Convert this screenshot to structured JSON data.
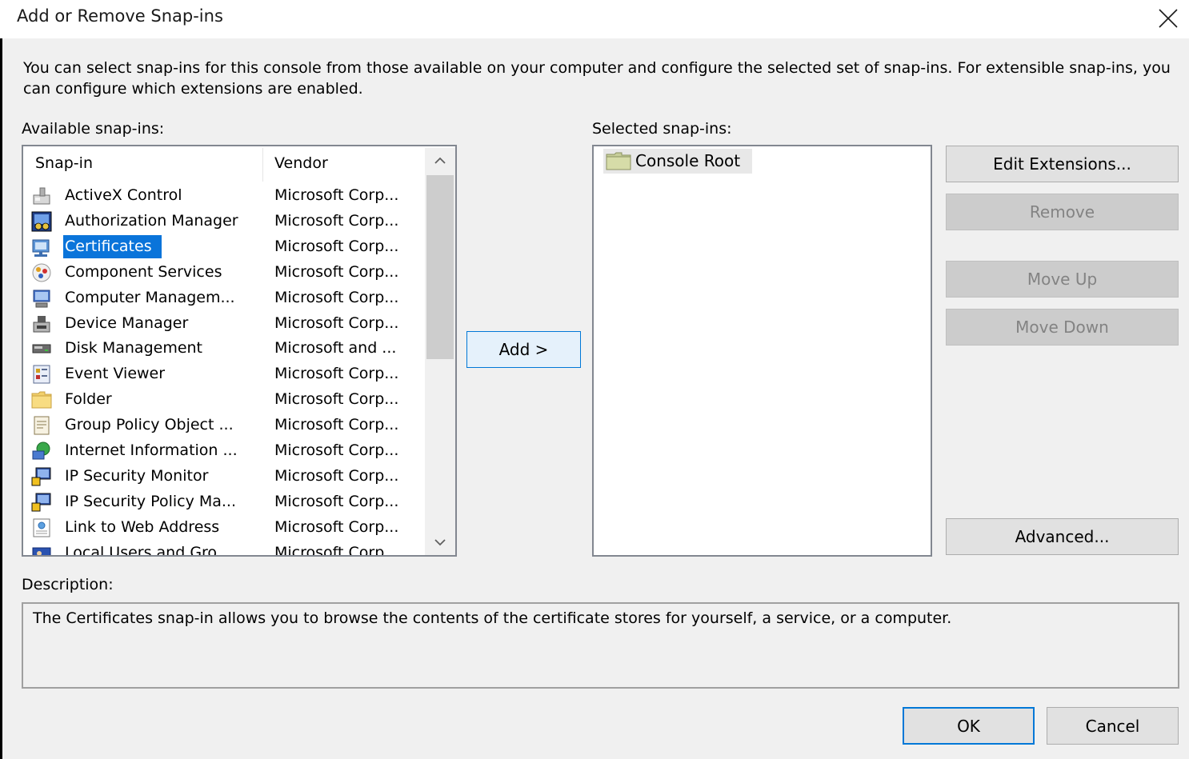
{
  "window": {
    "title": "Add or Remove Snap-ins"
  },
  "intro_text": "You can select snap-ins for this console from those available on your computer and configure the selected set of snap-ins. For extensible snap-ins, you can configure which extensions are enabled.",
  "available": {
    "label": "Available snap-ins:",
    "columns": {
      "snapin": "Snap-in",
      "vendor": "Vendor"
    },
    "items": [
      {
        "name": "ActiveX Control",
        "vendor": "Microsoft Corp...",
        "icon": "activex-control-icon"
      },
      {
        "name": "Authorization Manager",
        "vendor": "Microsoft Corp...",
        "icon": "authorization-manager-icon"
      },
      {
        "name": "Certificates",
        "vendor": "Microsoft Corp...",
        "icon": "certificates-icon",
        "selected": true
      },
      {
        "name": "Component Services",
        "vendor": "Microsoft Corp...",
        "icon": "component-services-icon"
      },
      {
        "name": "Computer Managem...",
        "vendor": "Microsoft Corp...",
        "icon": "computer-management-icon"
      },
      {
        "name": "Device Manager",
        "vendor": "Microsoft Corp...",
        "icon": "device-manager-icon"
      },
      {
        "name": "Disk Management",
        "vendor": "Microsoft and ...",
        "icon": "disk-management-icon"
      },
      {
        "name": "Event Viewer",
        "vendor": "Microsoft Corp...",
        "icon": "event-viewer-icon"
      },
      {
        "name": "Folder",
        "vendor": "Microsoft Corp...",
        "icon": "folder-icon"
      },
      {
        "name": "Group Policy Object ...",
        "vendor": "Microsoft Corp...",
        "icon": "group-policy-icon"
      },
      {
        "name": "Internet Information ...",
        "vendor": "Microsoft Corp...",
        "icon": "iis-icon"
      },
      {
        "name": "IP Security Monitor",
        "vendor": "Microsoft Corp...",
        "icon": "ip-security-monitor-icon"
      },
      {
        "name": "IP Security Policy Ma...",
        "vendor": "Microsoft Corp...",
        "icon": "ip-security-policy-icon"
      },
      {
        "name": "Link to Web Address",
        "vendor": "Microsoft Corp...",
        "icon": "web-link-icon"
      },
      {
        "name": "Local Users and Gro...",
        "vendor": "Microsoft Corp...",
        "icon": "local-users-icon"
      }
    ]
  },
  "add_button": "Add >",
  "selected": {
    "label": "Selected snap-ins:",
    "items": [
      {
        "name": "Console Root",
        "icon": "folder-icon"
      }
    ]
  },
  "buttons": {
    "edit_extensions": "Edit Extensions...",
    "remove": "Remove",
    "move_up": "Move Up",
    "move_down": "Move Down",
    "advanced": "Advanced...",
    "ok": "OK",
    "cancel": "Cancel"
  },
  "description": {
    "label": "Description:",
    "text": "The Certificates snap-in allows you to browse the contents of the certificate stores for yourself, a service, or a computer."
  },
  "colors": {
    "selection": "#0a74da",
    "accent_border": "#0078d7",
    "dialog_bg": "#f0f0f0"
  }
}
